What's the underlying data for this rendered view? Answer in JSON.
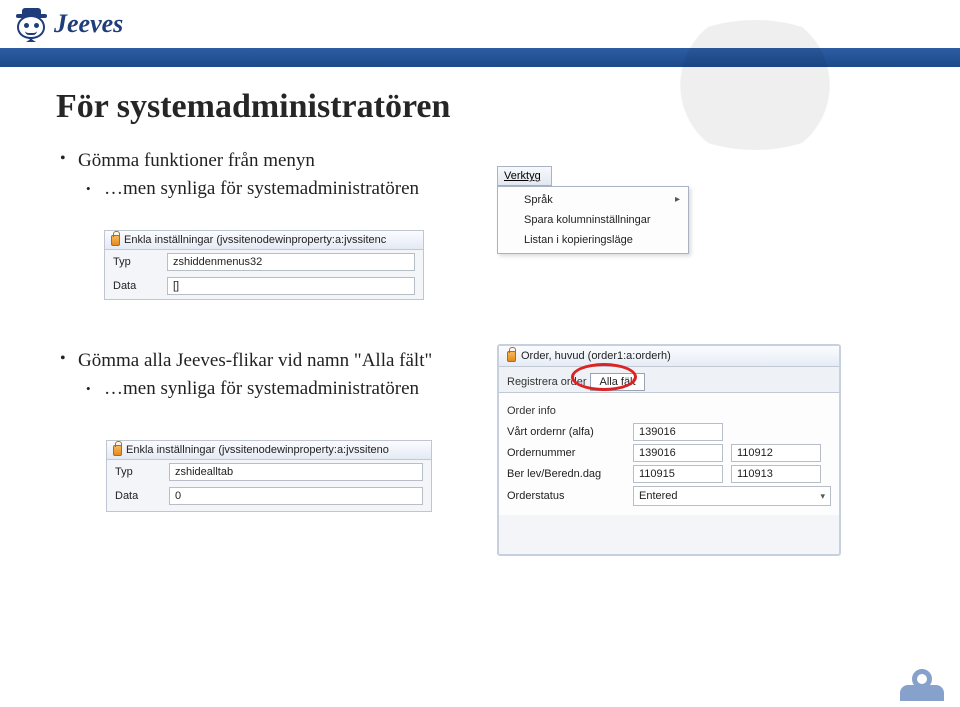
{
  "brand": {
    "name": "Jeeves"
  },
  "title": "För systemadministratören",
  "bullets": {
    "b1": "Gömma funktioner från menyn",
    "b2": "…men synliga för systemadministratören",
    "b3": "Gömma alla Jeeves-flikar vid namn \"Alla fält\"",
    "b4": "…men synliga för systemadministratören"
  },
  "shot1": {
    "title": "Enkla inställningar (jvssitenodewinproperty:a:jvssitenc",
    "rows": {
      "typ_label": "Typ",
      "typ_value": "zshiddenmenus32",
      "data_label": "Data",
      "data_value": "[]"
    }
  },
  "menu1": {
    "title": "Verktyg",
    "items": [
      "Språk",
      "Spara kolumninställningar",
      "Listan i kopieringsläge"
    ]
  },
  "shot2": {
    "title": "Enkla inställningar (jvssitenodewinproperty:a:jvssiteno",
    "rows": {
      "typ_label": "Typ",
      "typ_value": "zshidealltab",
      "data_label": "Data",
      "data_value": "0"
    }
  },
  "order": {
    "title": "Order, huvud (order1:a:orderh)",
    "tabs": {
      "main": "Registrera order",
      "all": "Alla fält"
    },
    "section": "Order info",
    "fields": {
      "f1_label": "Vårt ordernr (alfa)",
      "f1_v1": "139016",
      "f2_label": "Ordernummer",
      "f2_v1": "139016",
      "f2_v2": "110912",
      "f3_label": "Ber lev/Beredn.dag",
      "f3_v1": "110915",
      "f3_v2": "110913",
      "f4_label": "Orderstatus",
      "f4_v1": "Entered"
    }
  }
}
